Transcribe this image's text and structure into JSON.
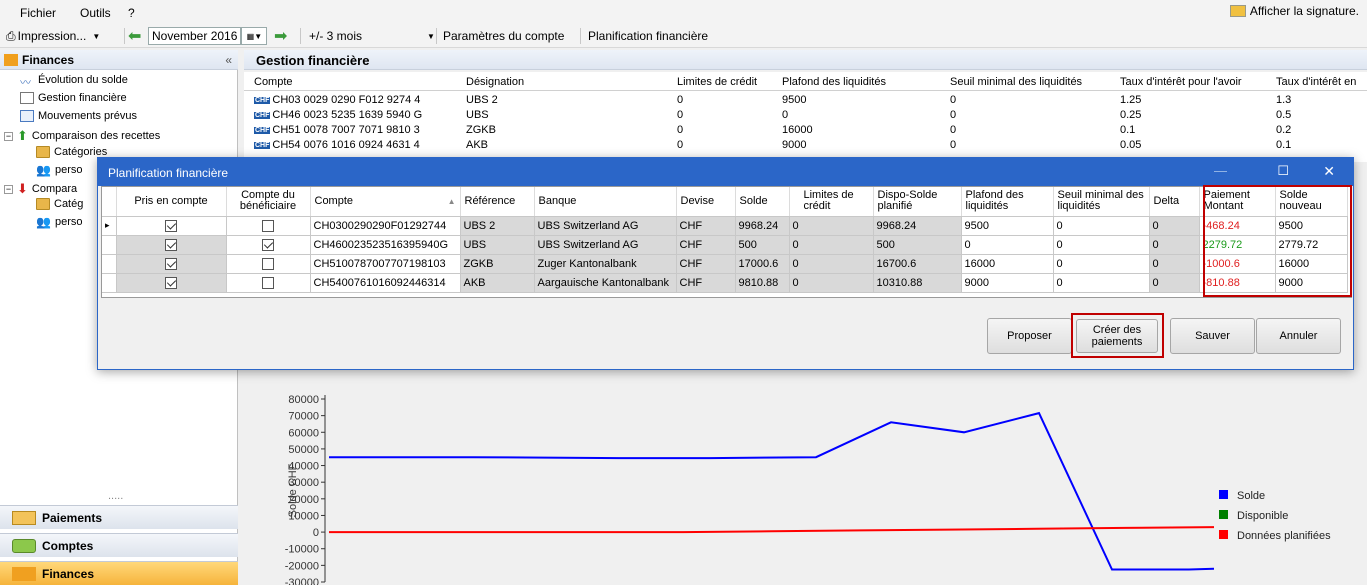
{
  "menu": {
    "file": "Fichier",
    "tools": "Outils",
    "help": "?",
    "signature": "Afficher la signature."
  },
  "toolbar": {
    "print": "Impression...",
    "month": "November 2016",
    "range": "+/- 3 mois",
    "account_params": "Paramètres du compte",
    "planning": "Planification financière"
  },
  "sidebar": {
    "title": "Finances",
    "items": [
      "Évolution du solde",
      "Gestion financière",
      "Mouvements prévus",
      "Comparaison des recettes",
      "Catégories",
      "perso",
      "Compara",
      "Catég",
      "perso"
    ],
    "dots": ".....",
    "nav": [
      "Paiements",
      "Comptes",
      "Finances"
    ]
  },
  "main": {
    "title": "Gestion financière",
    "columns": [
      "Compte",
      "Désignation",
      "Limites de crédit",
      "Plafond des liquidités",
      "Seuil minimal des liquidités",
      "Taux d'intérêt pour l'avoir",
      "Taux d'intérêt en"
    ],
    "rows": [
      [
        "CH03 0029 0290 F012 9274 4",
        "UBS 2",
        "0",
        "9500",
        "0",
        "1.25",
        "1.3"
      ],
      [
        "CH46 0023 5235 1639 5940 G",
        "UBS",
        "0",
        "0",
        "0",
        "0.25",
        "0.5"
      ],
      [
        "CH51 0078 7007 7071 9810 3",
        "ZGKB",
        "0",
        "16000",
        "0",
        "0.1",
        "0.2"
      ],
      [
        "CH54 0076 1016 0924 4631 4",
        "AKB",
        "0",
        "9000",
        "0",
        "0.05",
        "0.1"
      ]
    ],
    "chf_badge": "CHF"
  },
  "dialog": {
    "title": "Planification financière",
    "headers": [
      "Pris en compte",
      "Compte du bénéficiaire",
      "Compte",
      "Référence",
      "Banque",
      "Devise",
      "Solde",
      "Limites de crédit",
      "Dispo-Solde planifié",
      "Plafond des liquidités",
      "Seuil minimal des liquidités",
      "Delta",
      "Paiement Montant",
      "Solde nouveau"
    ],
    "rows": [
      {
        "taken": true,
        "benef": false,
        "compte": "CH0300290290F01292744",
        "ref": "UBS 2",
        "bank": "UBS Switzerland AG",
        "cur": "CHF",
        "solde": "9968.24",
        "limit": "0",
        "dispo": "9968.24",
        "plafond": "9500",
        "seuil": "0",
        "delta": "0",
        "payment": "-468.24",
        "newbal": "9500",
        "pay_color": "red"
      },
      {
        "taken": true,
        "benef": true,
        "compte": "CH460023523516395940G",
        "ref": "UBS",
        "bank": "UBS Switzerland AG",
        "cur": "CHF",
        "solde": "500",
        "limit": "0",
        "dispo": "500",
        "plafond": "0",
        "seuil": "0",
        "delta": "0",
        "payment": "2279.72",
        "newbal": "2779.72",
        "pay_color": "green"
      },
      {
        "taken": true,
        "benef": false,
        "compte": "CH5100787007707198103",
        "ref": "ZGKB",
        "bank": "Zuger Kantonalbank",
        "cur": "CHF",
        "solde": "17000.6",
        "limit": "0",
        "dispo": "16700.6",
        "plafond": "16000",
        "seuil": "0",
        "delta": "0",
        "payment": "-1000.6",
        "newbal": "16000",
        "pay_color": "red"
      },
      {
        "taken": true,
        "benef": false,
        "compte": "CH5400761016092446314",
        "ref": "AKB",
        "bank": "Aargauische Kantonalbank",
        "cur": "CHF",
        "solde": "9810.88",
        "limit": "0",
        "dispo": "10310.88",
        "plafond": "9000",
        "seuil": "0",
        "delta": "0",
        "payment": "-810.88",
        "newbal": "9000",
        "pay_color": "red"
      }
    ],
    "buttons": {
      "propose": "Proposer",
      "create": "Créer des paiements",
      "save": "Sauver",
      "cancel": "Annuler"
    }
  },
  "chart_data": {
    "type": "line",
    "ylabel": "Solde CHF",
    "ylim": [
      -30000,
      80000
    ],
    "yticks": [
      "80000",
      "70000",
      "60000",
      "50000",
      "40000",
      "30000",
      "20000",
      "10000",
      "0",
      "-10000",
      "-20000",
      "-30000"
    ],
    "series": [
      {
        "name": "Solde",
        "color": "#0000ff",
        "values": [
          45000,
          45000,
          44500,
          44500,
          45000,
          66000,
          60000,
          71500,
          -22500,
          -22500,
          -22000
        ]
      },
      {
        "name": "Disponible",
        "color": "#008000",
        "values": []
      },
      {
        "name": "Données planifiées",
        "color": "#ff0000",
        "values": [
          0,
          0,
          0,
          0,
          0,
          500,
          1000,
          1500,
          2000,
          2500,
          3000
        ]
      }
    ],
    "x": [
      0,
      1,
      2,
      3,
      4,
      5,
      6,
      7,
      8,
      9,
      10
    ]
  }
}
